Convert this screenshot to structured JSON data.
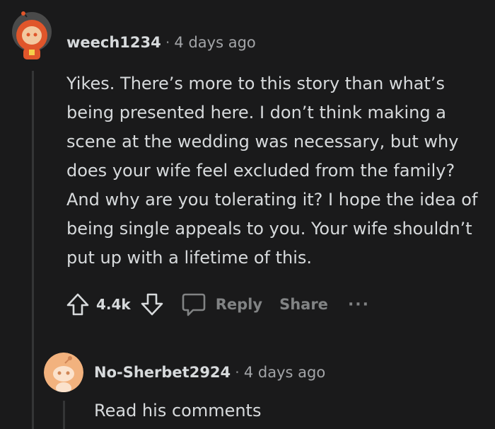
{
  "comment": {
    "username": "weech1234",
    "separator": "·",
    "time": "4 days ago",
    "body": "Yikes. There’s more to this story than what’s being presented here. I don’t think making a scene at the wedding was necessary, but why does your wife feel excluded from the family? And why are you tolerating it? I hope the idea of being single appeals to you. Your wife shouldn’t put up with a lifetime of this.",
    "votes": "4.4k",
    "reply_label": "Reply",
    "share_label": "Share",
    "more_label": "···",
    "avatar_icon": "snoo-avatar-orange-hood"
  },
  "reply": {
    "username": "No-Sherbet2924",
    "separator": "·",
    "time": "4 days ago",
    "body": "Read his comments",
    "avatar_icon": "snoo-avatar-default"
  },
  "colors": {
    "background": "#1a1a1b",
    "text": "#d7dadc",
    "muted": "#818384",
    "thread_line": "#343536",
    "avatar_orange": "#e0562b",
    "avatar_peach": "#f2b27e"
  }
}
